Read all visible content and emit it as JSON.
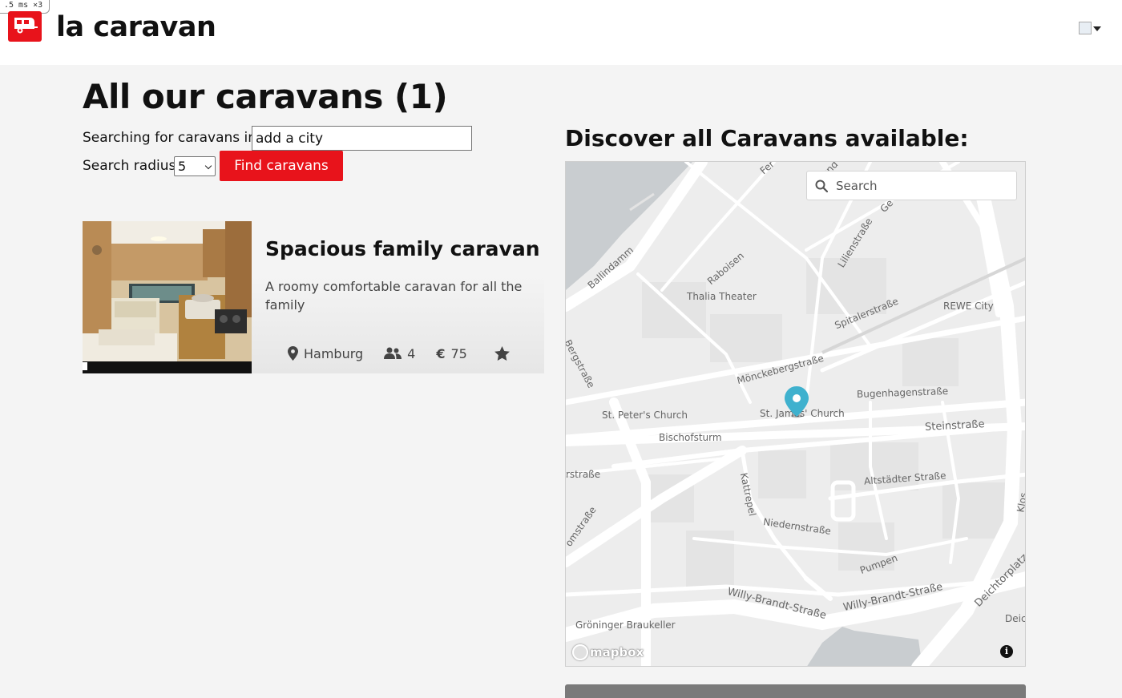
{
  "debug": {
    "badge": ".5 ms ×3"
  },
  "header": {
    "brand": "la caravan",
    "logo_icon": "caravan-icon"
  },
  "main": {
    "title": "All our caravans (1)",
    "search": {
      "label": "Searching for caravans in:",
      "city_value": "add a city",
      "radius_label": "Search radius",
      "radius_value": "5",
      "button": "Find caravans"
    }
  },
  "caravans": [
    {
      "title": "Spacious family caravan",
      "description": "A roomy comfortable caravan for all the family",
      "city": "Hamburg",
      "capacity": "4",
      "price_symbol": "€",
      "price": "75"
    }
  ],
  "map": {
    "title": "Discover all Caravans available:",
    "search_placeholder": "Search",
    "attribution": "mapbox",
    "info": "i",
    "labels": {
      "thalia": "Thalia Theater",
      "rewe": "REWE City",
      "raboisen": "Raboisen",
      "ballindamm": "Ballindamm",
      "lilienstrasse": "Lilienstraße",
      "spitalerstrasse": "Spitalerstraße",
      "bergstrasse": "Bergstraße",
      "moenckeberg": "Mönckebergstraße",
      "bugenhagen": "Bugenhagenstraße",
      "st_peter": "St. Peter's Church",
      "st_james": "St. James' Church",
      "steinstrasse": "Steinstraße",
      "bischofsturm": "Bischofsturm",
      "rstrasse": "rstraße",
      "altstaedter": "Altstädter Straße",
      "kattrepel": "Kattrepel",
      "niedernstrasse": "Niedernstraße",
      "omstrasse": "omstraße",
      "pumpen": "Pumpen",
      "willy1": "Willy-Brandt-Straße",
      "willy2": "Willy-Brandt-Straße",
      "deichtorplatz": "Deichtorplatz",
      "groeninger": "Gröninger Braukeller",
      "deic": "Deic",
      "klos": "Klos",
      "fer": "Fer",
      "und": "und",
      "ge": "Ge"
    }
  },
  "colors": {
    "accent": "#e8131b",
    "marker": "#3fb1ce"
  }
}
